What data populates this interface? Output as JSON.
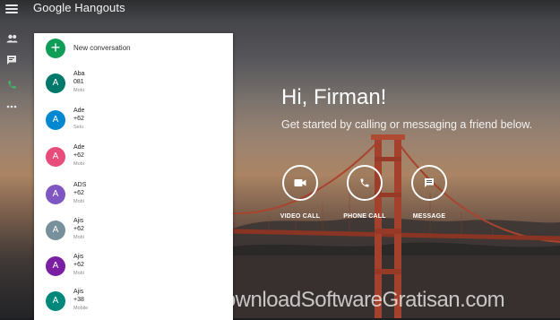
{
  "header": {
    "title": "Google Hangouts"
  },
  "rail": {
    "items": [
      {
        "icon": "contacts-icon"
      },
      {
        "icon": "chat-icon"
      },
      {
        "icon": "phone-icon"
      },
      {
        "icon": "more-icon"
      }
    ]
  },
  "panel": {
    "new_conversation": "New conversation",
    "contacts": [
      {
        "initial": "A",
        "name": "Aba",
        "phone": "081",
        "type": "Mobi",
        "color": "#00796b"
      },
      {
        "initial": "A",
        "name": "Ade",
        "phone": "+62",
        "type": "Selu",
        "color": "#0288d1"
      },
      {
        "initial": "A",
        "name": "Ade",
        "phone": "+62",
        "type": "Mobi",
        "color": "#e84c7a"
      },
      {
        "initial": "A",
        "name": "ADS",
        "phone": "+62",
        "type": "Mobi",
        "color": "#7e57c2"
      },
      {
        "initial": "A",
        "name": "Ajis",
        "phone": "+62",
        "type": "Mobi",
        "color": "#78909c"
      },
      {
        "initial": "A",
        "name": "Ajis",
        "phone": "+62",
        "type": "Mobi",
        "color": "#7b1fa2"
      },
      {
        "initial": "A",
        "name": "Ajis",
        "phone": "+38",
        "type": "Mobile",
        "color": "#00897b"
      }
    ]
  },
  "main": {
    "greeting": "Hi, Firman!",
    "subtext": "Get started by calling or messaging a friend below.",
    "actions": [
      {
        "label": "VIDEO CALL",
        "icon": "video-camera-icon"
      },
      {
        "label": "PHONE CALL",
        "icon": "phone-icon"
      },
      {
        "label": "MESSAGE",
        "icon": "message-icon"
      }
    ]
  },
  "watermark": "DownloadSoftwareGratisan.com"
}
